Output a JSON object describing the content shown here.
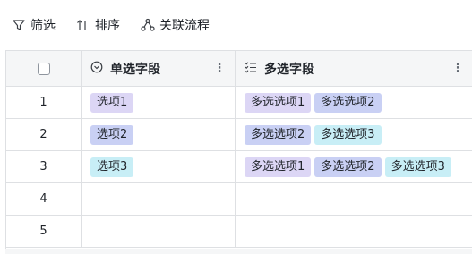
{
  "toolbar": {
    "filter_label": "筛选",
    "sort_label": "排序",
    "flow_label": "关联流程"
  },
  "table": {
    "columns": {
      "single_label": "单选字段",
      "multi_label": "多选字段",
      "more_symbol": "⋮"
    },
    "rows": [
      {
        "index": "1",
        "single": "选项1",
        "multi": [
          "多选选项1",
          "多选选项2"
        ]
      },
      {
        "index": "2",
        "single": "选项2",
        "multi": [
          "多选选项2",
          "多选选项3"
        ]
      },
      {
        "index": "3",
        "single": "选项3",
        "multi": [
          "多选选项1",
          "多选选项2",
          "多选选项3"
        ]
      },
      {
        "index": "4",
        "single": "",
        "multi": []
      },
      {
        "index": "5",
        "single": "",
        "multi": []
      }
    ]
  },
  "tag_colors": {
    "选项1": "#dcd6f5",
    "选项2": "#c9d0f4",
    "选项3": "#c8eef6",
    "多选选项1": "#dcd6f5",
    "多选选项2": "#c9d0f4",
    "多选选项3": "#c8eef6"
  },
  "icons": {
    "filter": "filter-icon",
    "sort": "sort-icon",
    "flow": "flow-icon",
    "single_select": "single-select-icon",
    "multi_select": "multi-select-icon"
  }
}
